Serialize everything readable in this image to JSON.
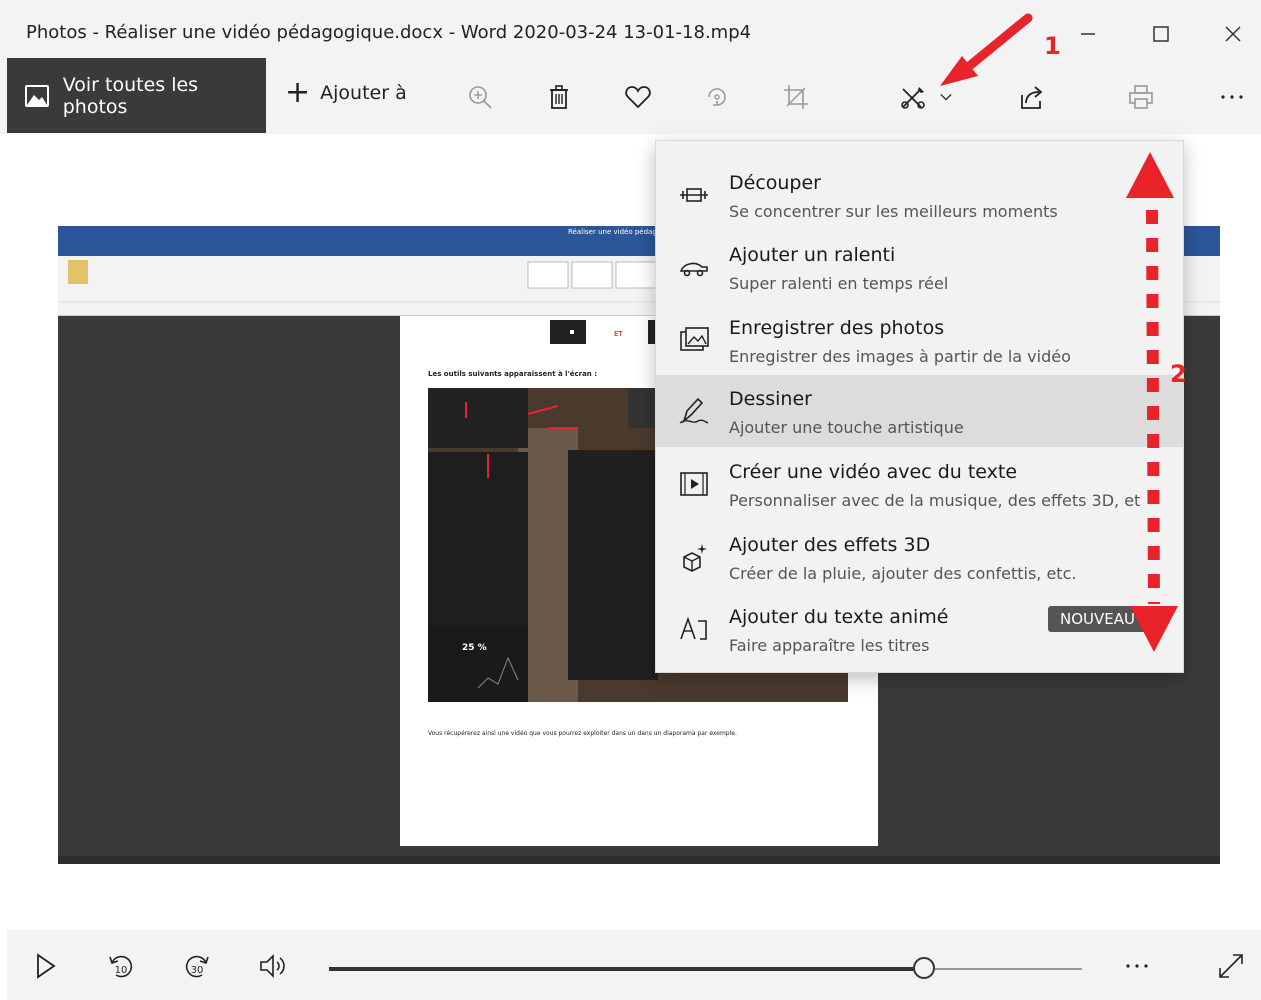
{
  "window": {
    "title": "Photos - Réaliser une vidéo pédagogique.docx - Word 2020-03-24 13-01-18.mp4"
  },
  "toolbar": {
    "view_all": "Voir toutes les photos",
    "add_to": "Ajouter à"
  },
  "menu": {
    "items": [
      {
        "title": "Découper",
        "subtitle": "Se concentrer sur les meilleurs moments",
        "icon": "trim-icon"
      },
      {
        "title": "Ajouter un ralenti",
        "subtitle": "Super ralenti en temps réel",
        "icon": "slow-motion-icon"
      },
      {
        "title": "Enregistrer des photos",
        "subtitle": "Enregistrer des images à partir de la vidéo",
        "icon": "save-photos-icon"
      },
      {
        "title": "Dessiner",
        "subtitle": "Ajouter une touche artistique",
        "icon": "draw-icon"
      },
      {
        "title": "Créer une vidéo avec du texte",
        "subtitle": "Personnaliser avec de la musique, des effets 3D, et",
        "icon": "video-text-icon"
      },
      {
        "title": "Ajouter des effets 3D",
        "subtitle": "Créer de la pluie, ajouter des confettis, etc.",
        "icon": "effects-3d-icon"
      },
      {
        "title": "Ajouter du texte animé",
        "subtitle": "Faire apparaître les titres",
        "icon": "animated-text-icon",
        "badge": "NOUVEAU"
      }
    ],
    "active_item": "Dessiner"
  },
  "annotations": {
    "step1": "1",
    "step2": "2",
    "color": "#e8232a"
  },
  "video_frame": {
    "doc_heading": "Les outils suivants apparaissent à l'écran :",
    "doc_footer": "Vous récupérerez ainsi une vidéo que vous pourrez exploiter dans un dans un diaporama par exemple.",
    "percent": "25 %",
    "title_bar": "Réaliser une vidéo pédago"
  },
  "playback": {
    "skip_back": "10",
    "skip_forward": "30",
    "progress": 0.79
  },
  "colors": {
    "chrome": "#f3f3f3",
    "view_all_bg": "#3a3a3a",
    "menu_bg": "#f2f2f2",
    "menu_active": "#dcdcdc"
  }
}
